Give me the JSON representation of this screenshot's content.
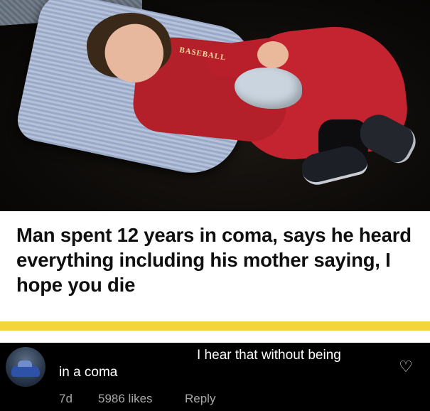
{
  "headline": {
    "text": "Man spent 12 years in coma, says he heard everything including his mother saying, I hope you die"
  },
  "photo": {
    "shirt_text": "BASEBALL"
  },
  "comment": {
    "line1": "I hear that without being",
    "line2": "in a coma",
    "time": "7d",
    "likes": "5986 likes",
    "reply_label": "Reply",
    "heart_icon": "heart-outline-icon"
  },
  "colors": {
    "highlight_bar": "#f3d53b",
    "comment_bg": "#000000",
    "meta_text": "#a8a8a8"
  }
}
